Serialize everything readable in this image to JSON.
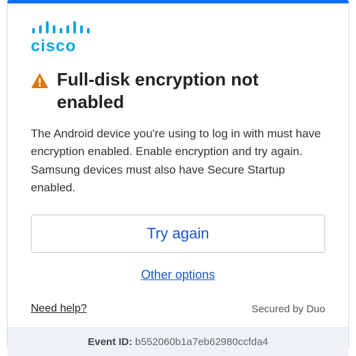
{
  "brand": {
    "name": "cisco",
    "color": "#0ca6e0"
  },
  "alert": {
    "icon": "warning-icon",
    "title": "Full-disk encryption not enabled",
    "description": "The Android device you're using to log in with must have encryption enabled. Enable encryption and try again. Samsung devices must also have Secure Startup enabled."
  },
  "actions": {
    "primary_label": "Try again",
    "secondary_label": "Other options"
  },
  "footer": {
    "help_label": "Need help?",
    "secured_label": "Secured by Duo"
  },
  "event": {
    "label": "Event ID:",
    "value": "b552060b1a7eb62980ccfda4"
  }
}
